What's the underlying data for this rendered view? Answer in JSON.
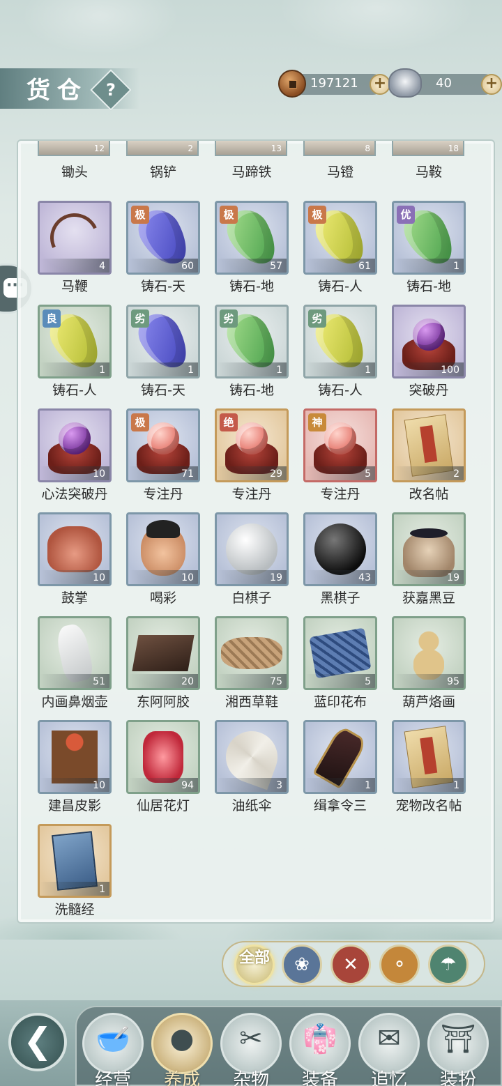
{
  "header": {
    "title": "货仓",
    "help_label": "?",
    "copper": {
      "value": "197121",
      "plus": "+"
    },
    "silver": {
      "value": "40",
      "plus": "+"
    }
  },
  "partial_row": [
    {
      "name": "锄头",
      "count": "12"
    },
    {
      "name": "锅铲",
      "count": "2"
    },
    {
      "name": "马蹄铁",
      "count": "13"
    },
    {
      "name": "马镫",
      "count": "8"
    },
    {
      "name": "马鞍",
      "count": "18"
    }
  ],
  "items": [
    {
      "name": "马鞭",
      "count": "4",
      "grade": "",
      "quality": "q-purple",
      "art": "whip"
    },
    {
      "name": "铸石-天",
      "count": "60",
      "grade": "极",
      "quality": "q-blue",
      "art": "crystal-blue"
    },
    {
      "name": "铸石-地",
      "count": "57",
      "grade": "极",
      "quality": "q-blue",
      "art": "crystal-green"
    },
    {
      "name": "铸石-人",
      "count": "61",
      "grade": "极",
      "quality": "q-blue",
      "art": "crystal-yellow"
    },
    {
      "name": "铸石-地",
      "count": "1",
      "grade": "优",
      "quality": "q-blue",
      "art": "crystal-green"
    },
    {
      "name": "铸石-人",
      "count": "1",
      "grade": "良",
      "quality": "q-green",
      "art": "crystal-yellow"
    },
    {
      "name": "铸石-天",
      "count": "1",
      "grade": "劣",
      "quality": "q-gray",
      "art": "crystal-blue"
    },
    {
      "name": "铸石-地",
      "count": "1",
      "grade": "劣",
      "quality": "q-gray",
      "art": "crystal-green"
    },
    {
      "name": "铸石-人",
      "count": "1",
      "grade": "劣",
      "quality": "q-gray",
      "art": "crystal-yellow"
    },
    {
      "name": "突破丹",
      "count": "100",
      "grade": "",
      "quality": "q-purple",
      "art": "pill-purple"
    },
    {
      "name": "心法突破丹",
      "count": "10",
      "grade": "",
      "quality": "q-purple",
      "art": "pill-purple"
    },
    {
      "name": "专注丹",
      "count": "71",
      "grade": "极",
      "quality": "q-blue",
      "art": "pill-pink"
    },
    {
      "name": "专注丹",
      "count": "29",
      "grade": "绝",
      "quality": "q-orange",
      "art": "pill-pink"
    },
    {
      "name": "专注丹",
      "count": "5",
      "grade": "神",
      "quality": "q-red",
      "art": "pill-pink"
    },
    {
      "name": "改名帖",
      "count": "2",
      "grade": "",
      "quality": "q-orange",
      "art": "card"
    },
    {
      "name": "鼓掌",
      "count": "10",
      "grade": "",
      "quality": "q-blue",
      "art": "hands"
    },
    {
      "name": "喝彩",
      "count": "10",
      "grade": "",
      "quality": "q-blue",
      "art": "face"
    },
    {
      "name": "白棋子",
      "count": "19",
      "grade": "",
      "quality": "q-blue",
      "art": "stone-white"
    },
    {
      "name": "黑棋子",
      "count": "43",
      "grade": "",
      "quality": "q-blue",
      "art": "stone-black"
    },
    {
      "name": "获嘉黑豆",
      "count": "19",
      "grade": "",
      "quality": "q-green",
      "art": "jar"
    },
    {
      "name": "内画鼻烟壶",
      "count": "51",
      "grade": "",
      "quality": "q-green",
      "art": "bottle"
    },
    {
      "name": "东阿阿胶",
      "count": "20",
      "grade": "",
      "quality": "q-green",
      "art": "glue"
    },
    {
      "name": "湘西草鞋",
      "count": "75",
      "grade": "",
      "quality": "q-green",
      "art": "shoes"
    },
    {
      "name": "蓝印花布",
      "count": "5",
      "grade": "",
      "quality": "q-green",
      "art": "cloth"
    },
    {
      "name": "葫芦烙画",
      "count": "95",
      "grade": "",
      "quality": "q-green",
      "art": "gourd"
    },
    {
      "name": "建昌皮影",
      "count": "10",
      "grade": "",
      "quality": "q-blue",
      "art": "puppet"
    },
    {
      "name": "仙居花灯",
      "count": "94",
      "grade": "",
      "quality": "q-green",
      "art": "lantern"
    },
    {
      "name": "油纸伞",
      "count": "3",
      "grade": "",
      "quality": "q-blue",
      "art": "umbrella"
    },
    {
      "name": "缉拿令三",
      "count": "1",
      "grade": "",
      "quality": "q-blue",
      "art": "token"
    },
    {
      "name": "宠物改名帖",
      "count": "1",
      "grade": "",
      "quality": "q-blue",
      "art": "card"
    },
    {
      "name": "洗髓经",
      "count": "1",
      "grade": "",
      "quality": "q-orange",
      "art": "book"
    }
  ],
  "filters": {
    "all_label": "全部"
  },
  "nav": [
    {
      "label": "经营",
      "glyph": "🥣",
      "active": false
    },
    {
      "label": "养成",
      "glyph": "●",
      "active": true
    },
    {
      "label": "杂物",
      "glyph": "✂",
      "active": false
    },
    {
      "label": "装备",
      "glyph": "👘",
      "active": false
    },
    {
      "label": "追忆",
      "glyph": "✉",
      "active": false
    },
    {
      "label": "装扮",
      "glyph": "⛩",
      "active": false
    }
  ]
}
